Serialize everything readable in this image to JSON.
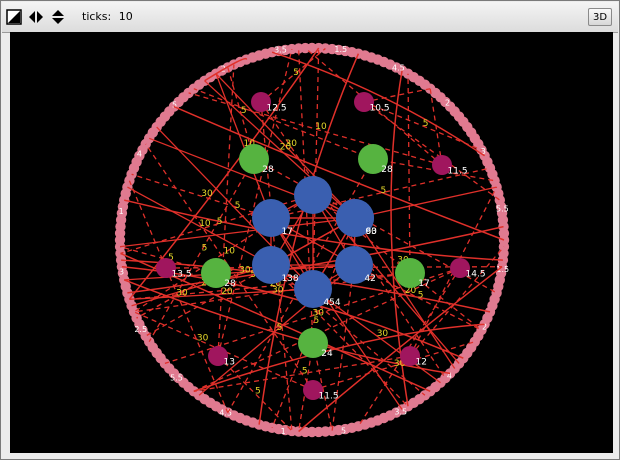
{
  "toolbar": {
    "ticks_label": "ticks:",
    "ticks_value": "10",
    "button_3d": "3D",
    "icons": [
      "zoom-box-icon",
      "arrow-left-right-icon",
      "arrow-up-down-icon"
    ]
  },
  "colors": {
    "background": "#000000",
    "ring": "#e07a90",
    "link": "#e0302a",
    "link_label": "#e6d92a",
    "node_label": "#ffffff",
    "blue": "#3a5fb0",
    "green": "#56b340",
    "magenta": "#a0165e"
  },
  "network": {
    "blue_nodes": [
      {
        "label": ""
      },
      {
        "label": "63"
      },
      {
        "label": "17"
      },
      {
        "label": "90"
      },
      {
        "label": "138"
      },
      {
        "label": "42"
      },
      {
        "label": "454"
      }
    ],
    "green_nodes": [
      {
        "label": "28"
      },
      {
        "label": "28"
      },
      {
        "label": "28"
      },
      {
        "label": "17"
      },
      {
        "label": "24"
      }
    ],
    "magenta_nodes": [
      {
        "label": "12.5"
      },
      {
        "label": "10.5"
      },
      {
        "label": "11.5"
      },
      {
        "label": "13.5"
      },
      {
        "label": "14.5"
      },
      {
        "label": "13"
      },
      {
        "label": "12"
      },
      {
        "label": "11.5"
      }
    ],
    "link_labels": [
      "5",
      "30",
      "20",
      "30",
      "20",
      "30",
      "10",
      "5",
      "5",
      "20",
      "5",
      "20",
      "30",
      "30",
      "20",
      "5",
      "5",
      "10",
      "30",
      "30",
      "5",
      "5",
      "30",
      "10",
      "5",
      "10",
      "5",
      "5",
      "20",
      "5",
      "30",
      "30",
      "5",
      "10",
      "5",
      "20"
    ],
    "ring_labels": [
      "1.5",
      "2",
      "4",
      "3.5",
      "5",
      "1",
      "4.5",
      "5.5",
      "2.5",
      "3",
      "1",
      "4",
      "5",
      "2",
      "3.5",
      "1.5",
      "4.5",
      "2",
      "3",
      "5.5"
    ]
  }
}
